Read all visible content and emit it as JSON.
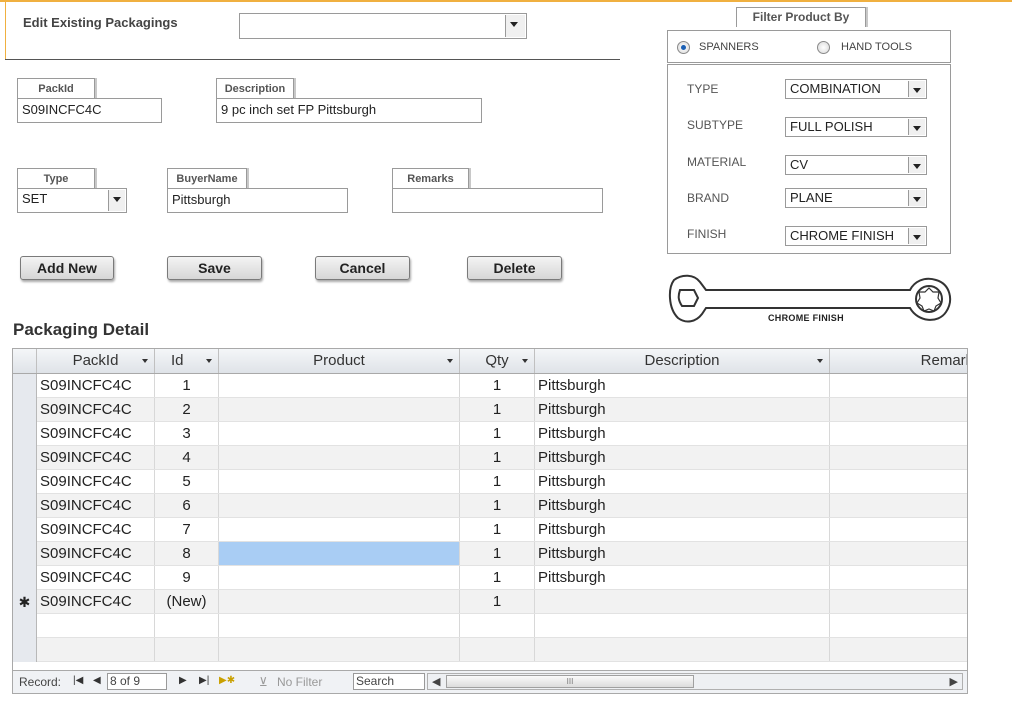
{
  "header": {
    "edit_label": "Edit Existing Packagings",
    "edit_value": ""
  },
  "fields": {
    "packid_label": "PackId",
    "packid_value": "S09INCFC4C",
    "description_label": "Description",
    "description_value": "9 pc inch set FP Pittsburgh",
    "type_label": "Type",
    "type_value": "SET",
    "buyername_label": "BuyerName",
    "buyername_value": "Pittsburgh",
    "remarks_label": "Remarks",
    "remarks_value": ""
  },
  "buttons": {
    "add_new": "Add New",
    "save": "Save",
    "cancel": "Cancel",
    "delete": "Delete"
  },
  "filter": {
    "title": "Filter Product By",
    "option_spanners": "SPANNERS",
    "option_hand_tools": "HAND TOOLS",
    "selected_option": "SPANNERS",
    "type_label": "TYPE",
    "type_value": "COMBINATION",
    "subtype_label": "SUBTYPE",
    "subtype_value": "FULL POLISH",
    "material_label": "MATERIAL",
    "material_value": "CV",
    "brand_label": "BRAND",
    "brand_value": "PLANE",
    "finish_label": "FINISH",
    "finish_value": "CHROME FINISH",
    "image_caption": "CHROME FINISH"
  },
  "detail": {
    "title": "Packaging Detail",
    "columns": [
      "PackId",
      "Id",
      "Product",
      "Qty",
      "Description",
      "Remarl"
    ],
    "rows": [
      {
        "packid": "S09INCFC4C",
        "id": "1",
        "product": "",
        "qty": "1",
        "description": "Pittsburgh"
      },
      {
        "packid": "S09INCFC4C",
        "id": "2",
        "product": "",
        "qty": "1",
        "description": "Pittsburgh"
      },
      {
        "packid": "S09INCFC4C",
        "id": "3",
        "product": "",
        "qty": "1",
        "description": "Pittsburgh"
      },
      {
        "packid": "S09INCFC4C",
        "id": "4",
        "product": "",
        "qty": "1",
        "description": "Pittsburgh"
      },
      {
        "packid": "S09INCFC4C",
        "id": "5",
        "product": "",
        "qty": "1",
        "description": "Pittsburgh"
      },
      {
        "packid": "S09INCFC4C",
        "id": "6",
        "product": "",
        "qty": "1",
        "description": "Pittsburgh"
      },
      {
        "packid": "S09INCFC4C",
        "id": "7",
        "product": "",
        "qty": "1",
        "description": "Pittsburgh"
      },
      {
        "packid": "S09INCFC4C",
        "id": "8",
        "product": "",
        "qty": "1",
        "description": "Pittsburgh"
      },
      {
        "packid": "S09INCFC4C",
        "id": "9",
        "product": "",
        "qty": "1",
        "description": "Pittsburgh"
      }
    ],
    "new_row": {
      "marker": "✱",
      "packid": "S09INCFC4C",
      "id": "(New)",
      "qty": "1"
    },
    "selected_row": 8
  },
  "status": {
    "record_label": "Record:",
    "record_value": "8 of 9",
    "no_filter": "No Filter",
    "search": "Search",
    "scroll_thumb": "III"
  },
  "colors": {
    "accent_line": "#f0b040",
    "selected_cell": "#a9cdf4"
  }
}
